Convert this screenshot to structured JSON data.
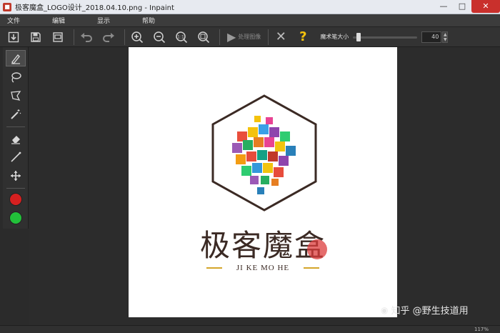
{
  "window": {
    "title": "极客魔盒_LOGO设计_2018.04.10.png - Inpaint",
    "minimize": "—",
    "maximize": "□",
    "close": "✕"
  },
  "menu": {
    "items": [
      "文件",
      "编辑",
      "显示",
      "帮助"
    ]
  },
  "toolbar": {
    "process_label": "处理图像",
    "brush_label": "魔术笔大小",
    "brush_size": "40",
    "brush_fraction": 0.05
  },
  "canvas": {
    "logo_cn": "极客魔盒",
    "logo_en": "JI KE MO HE"
  },
  "status": {
    "zoom": "117%"
  },
  "watermark": {
    "text": "知乎 @野生技道用"
  },
  "colors": {
    "red_tool": "#d62020",
    "green_tool": "#22c13a",
    "gold": "#d4a52a",
    "hexagon": "#3b2a24"
  }
}
